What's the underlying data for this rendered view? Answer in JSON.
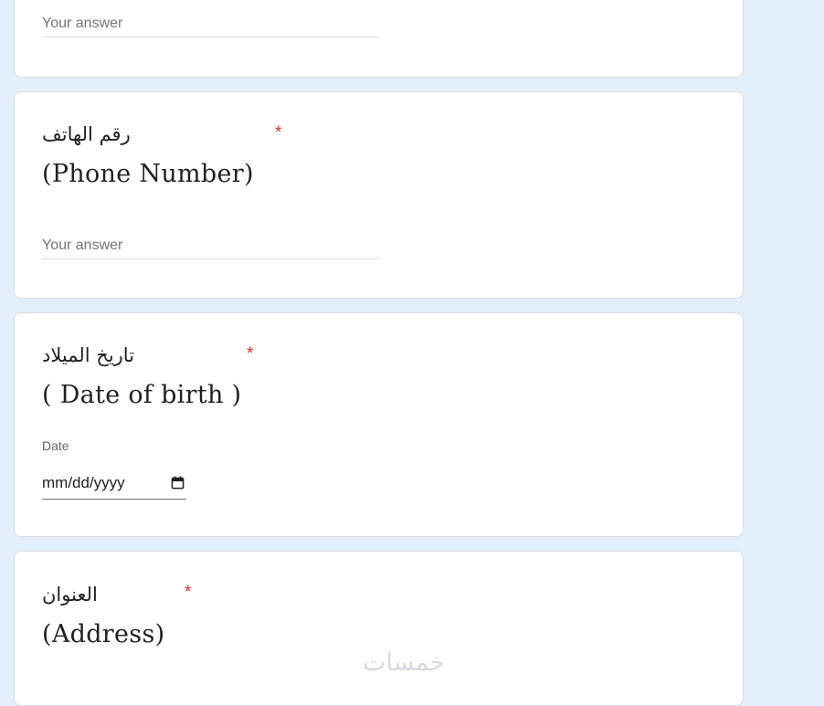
{
  "questions": [
    {
      "answer_placeholder": "Your answer"
    },
    {
      "title_ar": "رقم الهاتف",
      "title_en": "(Phone Number)",
      "required_mark": "*",
      "answer_placeholder": "Your answer"
    },
    {
      "title_ar": "تاريخ الميلاد",
      "title_en": "( Date of birth )",
      "required_mark": "*",
      "date_label": "Date",
      "date_value": "mm/dd/yyyy"
    },
    {
      "title_ar": "العنوان",
      "title_en": "(Address)",
      "required_mark": "*"
    }
  ],
  "watermark": "خمسات",
  "colors": {
    "background": "#e3f0fb",
    "card": "#ffffff",
    "required": "#d93025",
    "text": "#202124",
    "placeholder": "#70757a"
  }
}
